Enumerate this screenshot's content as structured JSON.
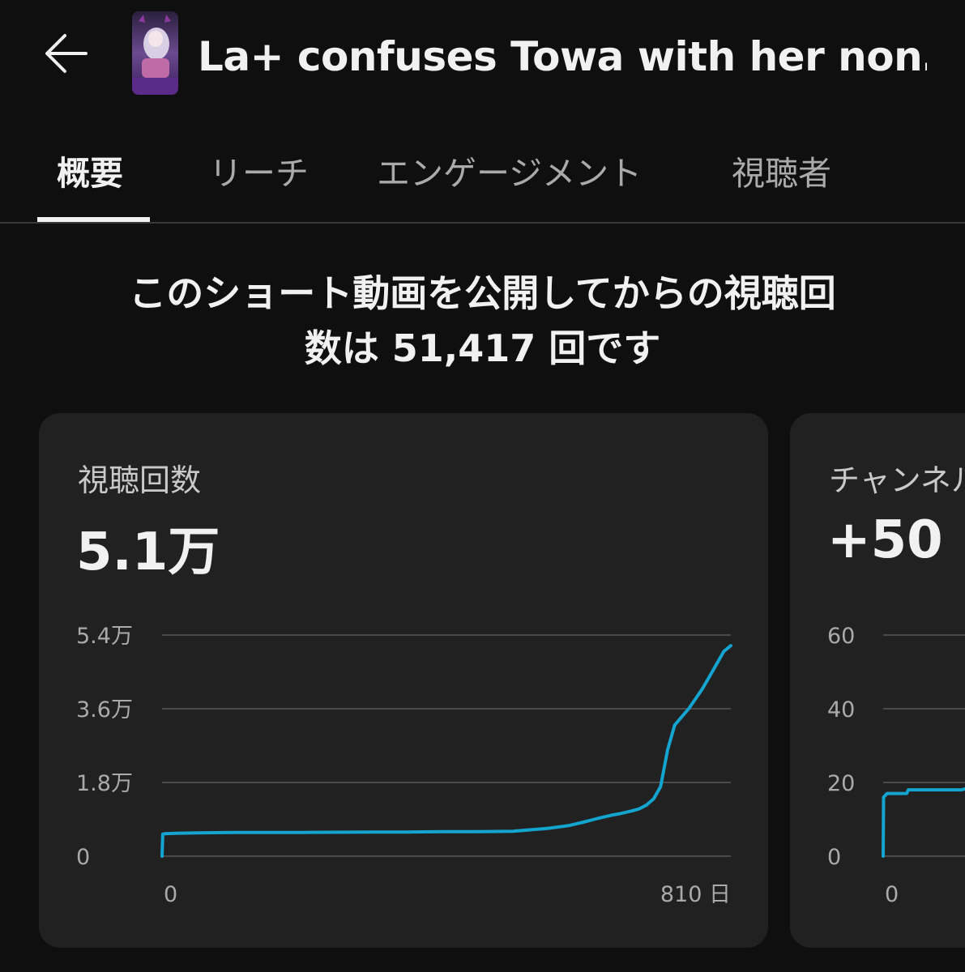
{
  "header": {
    "back_icon": "arrow-left-icon",
    "title": "La+ confuses Towa with her non…",
    "thumbnail": "video-thumbnail"
  },
  "tabs": [
    {
      "label": "概要",
      "active": true
    },
    {
      "label": "リーチ",
      "active": false
    },
    {
      "label": "エンゲージメント",
      "active": false
    },
    {
      "label": "視聴者",
      "active": false
    }
  ],
  "summary": {
    "line1": "このショート動画を公開してからの視聴回",
    "line2": "数は 51,417 回です"
  },
  "cards": [
    {
      "label": "視聴回数",
      "value": "5.1万"
    },
    {
      "label": "チャンネル",
      "value": "+50"
    }
  ],
  "colors": {
    "line": "#14a4d0",
    "background": "#0f0f0f",
    "card": "#212121",
    "grid": "#4a4a4a"
  },
  "chart_data": [
    {
      "type": "line",
      "title": "視聴回数",
      "ylim": [
        0,
        54000
      ],
      "y_ticks": [
        0,
        18000,
        36000,
        54000
      ],
      "y_tick_labels": [
        "0",
        "1.8万",
        "3.6万",
        "5.4万"
      ],
      "x_tick_labels": [
        "0",
        "810 日"
      ],
      "xlim": [
        0,
        810
      ],
      "grid": true,
      "series": [
        {
          "x": [
            0,
            1,
            5,
            20,
            50,
            100,
            200,
            300,
            350,
            400,
            450,
            500,
            550,
            580,
            600,
            620,
            640,
            650,
            660,
            670,
            680,
            690,
            700,
            710,
            720,
            730,
            740,
            750,
            760,
            770,
            780,
            790,
            800,
            810
          ],
          "y": [
            0,
            5400,
            5500,
            5600,
            5700,
            5800,
            5800,
            5900,
            5900,
            6000,
            6000,
            6100,
            6800,
            7500,
            8300,
            9200,
            10000,
            10300,
            10700,
            11100,
            11600,
            12500,
            14000,
            17000,
            26000,
            32000,
            34000,
            36000,
            38500,
            41000,
            44000,
            47000,
            50000,
            51417
          ]
        }
      ]
    },
    {
      "type": "line",
      "title": "チャンネル",
      "ylim": [
        0,
        60
      ],
      "y_ticks": [
        0,
        20,
        40,
        60
      ],
      "y_tick_labels": [
        "0",
        "20",
        "40",
        "60"
      ],
      "x_tick_labels": [
        "0"
      ],
      "grid": true,
      "series": [
        {
          "x": [
            0,
            0.5,
            5,
            30,
            32,
            100,
            115,
            120
          ],
          "y": [
            0,
            16,
            17,
            17,
            18,
            18,
            19,
            19
          ]
        }
      ]
    }
  ]
}
